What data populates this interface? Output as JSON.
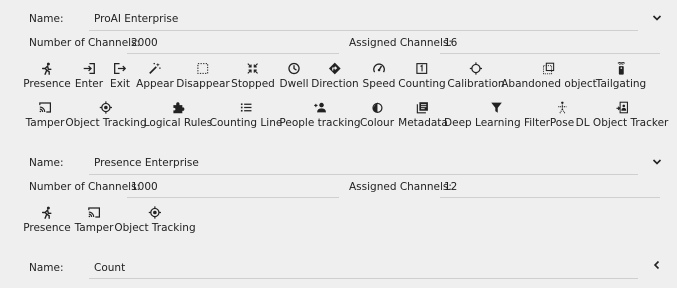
{
  "cards": [
    {
      "name_label": "Name:",
      "name_value": "ProAI Enterprise",
      "num_channels_label": "Number of Channels:",
      "num_channels_value": "2000",
      "assigned_label": "Assigned Channels:",
      "assigned_value": "16",
      "expanded": true,
      "features": [
        {
          "label": "Presence",
          "icon": "running-person-icon"
        },
        {
          "label": "Enter",
          "icon": "enter-icon"
        },
        {
          "label": "Exit",
          "icon": "exit-icon"
        },
        {
          "label": "Appear",
          "icon": "magic-wand-icon"
        },
        {
          "label": "Disappear",
          "icon": "dashed-square-icon"
        },
        {
          "label": "Stopped",
          "icon": "collapse-arrows-icon"
        },
        {
          "label": "Dwell",
          "icon": "clock-icon"
        },
        {
          "label": "Direction",
          "icon": "direction-sign-icon"
        },
        {
          "label": "Speed",
          "icon": "speedometer-icon"
        },
        {
          "label": "Counting",
          "icon": "counter-box-icon"
        },
        {
          "label": "Calibration",
          "icon": "crosshair-icon"
        },
        {
          "label": "Abandoned object",
          "icon": "abandoned-object-icon"
        },
        {
          "label": "Tailgating",
          "icon": "remote-icon"
        },
        {
          "label": "Tamper",
          "icon": "cast-icon"
        },
        {
          "label": "Object Tracking",
          "icon": "target-icon"
        },
        {
          "label": "Logical Rules",
          "icon": "puzzle-icon"
        },
        {
          "label": "Counting Line",
          "icon": "list-icon"
        },
        {
          "label": "People tracking",
          "icon": "people-icon"
        },
        {
          "label": "Colour",
          "icon": "half-circle-icon"
        },
        {
          "label": "Metadata",
          "icon": "library-icon"
        },
        {
          "label": "Deep Learning Filter",
          "icon": "filter-icon"
        },
        {
          "label": "Pose",
          "icon": "pose-icon"
        },
        {
          "label": "DL Object Tracker",
          "icon": "object-tracker-icon"
        }
      ]
    },
    {
      "name_label": "Name:",
      "name_value": "Presence Enterprise",
      "num_channels_label": "Number of Channels:",
      "num_channels_value": "1000",
      "assigned_label": "Assigned Channels:",
      "assigned_value": "12",
      "expanded": true,
      "features": [
        {
          "label": "Presence",
          "icon": "running-person-icon"
        },
        {
          "label": "Tamper",
          "icon": "cast-icon"
        },
        {
          "label": "Object Tracking",
          "icon": "target-icon"
        }
      ]
    },
    {
      "name_label": "Name:",
      "name_value": "Count",
      "expanded": false
    }
  ],
  "colors": {
    "background": "#efefef",
    "text": "#222222",
    "underline": "#cfcfcf"
  }
}
